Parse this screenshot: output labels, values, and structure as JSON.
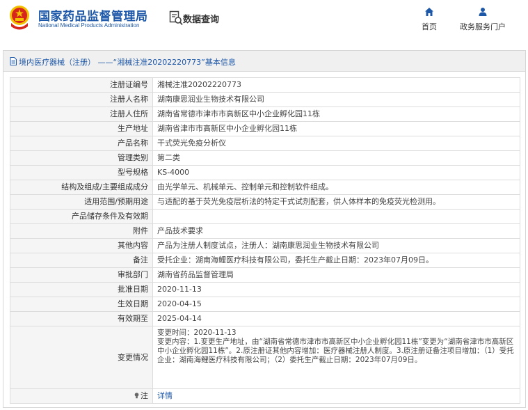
{
  "header": {
    "site_name_cn": "国家药品监督管理局",
    "site_name_en": "National Medical Products Administration",
    "search_label": "数据查询",
    "nav": [
      {
        "label": "首页",
        "icon": "home-icon"
      },
      {
        "label": "政务服务门户",
        "icon": "user-icon"
      }
    ]
  },
  "panel": {
    "title": "境内医疗器械（注册） ——“湘械注准20202220773”基本信息",
    "rows": [
      {
        "key": "注册证编号",
        "value": "湘械注准20202220773"
      },
      {
        "key": "注册人名称",
        "value": "湖南康思润业生物技术有限公司"
      },
      {
        "key": "注册人住所",
        "value": "湖南省常德市津市市高新区中小企业孵化园11栋"
      },
      {
        "key": "生产地址",
        "value": "湖南省津市市高新区中小企业孵化园11栋"
      },
      {
        "key": "产品名称",
        "value": "干式荧光免疫分析仪"
      },
      {
        "key": "管理类别",
        "value": "第二类"
      },
      {
        "key": "型号规格",
        "value": "KS-4000"
      },
      {
        "key": "结构及组成/主要组成成分",
        "value": "由光学单元、机械单元、控制单元和控制软件组成。"
      },
      {
        "key": "适用范围/预期用途",
        "value": "与适配的基于荧光免疫层析法的特定干式试剂配套，供人体样本的免疫荧光检测用。"
      },
      {
        "key": "产品储存条件及有效期",
        "value": ""
      },
      {
        "key": "附件",
        "value": "产品技术要求"
      },
      {
        "key": "其他内容",
        "value": "产品为注册人制度试点，注册人：湖南康思润业生物技术有限公司"
      },
      {
        "key": "备注",
        "value": "受托企业：湖南海鲤医疗科技有限公司，委托生产截止日期：2023年07月09日。"
      },
      {
        "key": "审批部门",
        "value": "湖南省药品监督管理局"
      },
      {
        "key": "批准日期",
        "value": "2020-11-13"
      },
      {
        "key": "生效日期",
        "value": "2020-04-15"
      },
      {
        "key": "有效期至",
        "value": "2025-04-14"
      }
    ],
    "change_key": "变更情况",
    "change_value": "变更时间：2020-11-13\n变更内容：1.变更生产地址，由“湖南省常德市津市市高新区中小企业孵化园11栋”变更为“湖南省津市市高新区中小企业孵化园11栋”。2.原注册证其他内容增加：医疗器械注册人制度。3.原注册证备注项目增加：（1）受托企业：湖南海鲤医疗科技有限公司；（2）委托生产截止日期：2023年07月09日。",
    "note_key": "注",
    "note_link": "详情"
  },
  "colors": {
    "brand_blue": "#1d57a8",
    "emblem_red": "#d7261c",
    "emblem_gold": "#f2c200"
  }
}
